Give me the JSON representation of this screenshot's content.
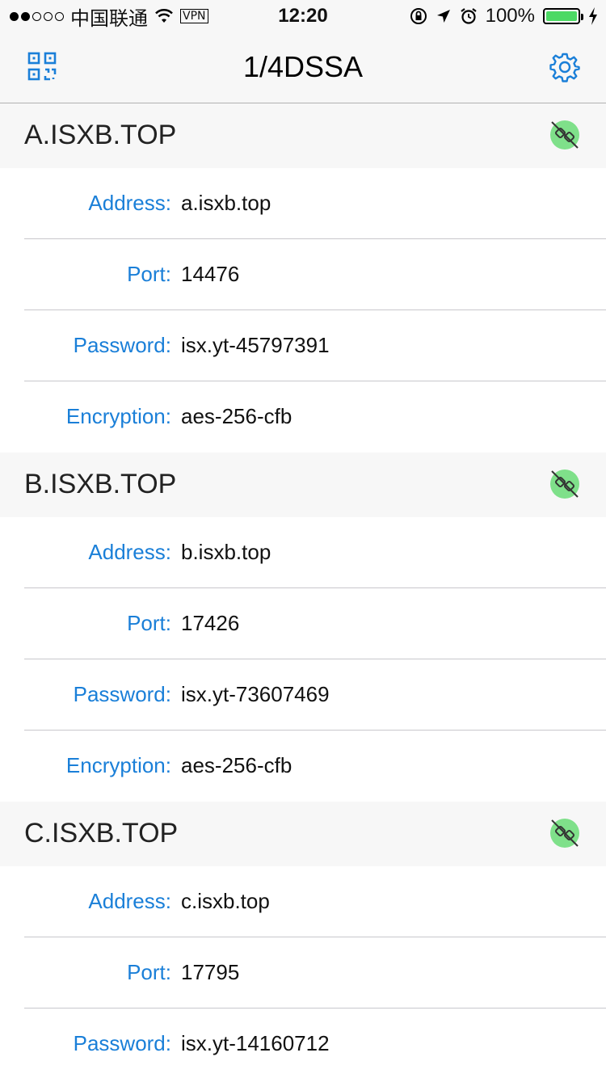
{
  "status_bar": {
    "carrier": "中国联通",
    "vpn": "VPN",
    "time": "12:20",
    "battery": "100%",
    "battery_level": 1.0,
    "battery_color": "#4cd964"
  },
  "nav": {
    "title": "1/4DSSA",
    "left_icon": "qr-code-icon",
    "right_icon": "gear-icon",
    "accent_color": "#1a7fd8"
  },
  "servers": [
    {
      "title": "A.ISXB.TOP",
      "rows": [
        {
          "label": "Address:",
          "value": "a.isxb.top"
        },
        {
          "label": "Port:",
          "value": "14476"
        },
        {
          "label": "Password:",
          "value": "isx.yt-45797391"
        },
        {
          "label": "Encryption:",
          "value": "aes-256-cfb"
        }
      ]
    },
    {
      "title": "B.ISXB.TOP",
      "rows": [
        {
          "label": "Address:",
          "value": "b.isxb.top"
        },
        {
          "label": "Port:",
          "value": "17426"
        },
        {
          "label": "Password:",
          "value": "isx.yt-73607469"
        },
        {
          "label": "Encryption:",
          "value": "aes-256-cfb"
        }
      ]
    },
    {
      "title": "C.ISXB.TOP",
      "rows": [
        {
          "label": "Address:",
          "value": "c.isxb.top"
        },
        {
          "label": "Port:",
          "value": "17795"
        },
        {
          "label": "Password:",
          "value": "isx.yt-14160712"
        }
      ]
    }
  ]
}
